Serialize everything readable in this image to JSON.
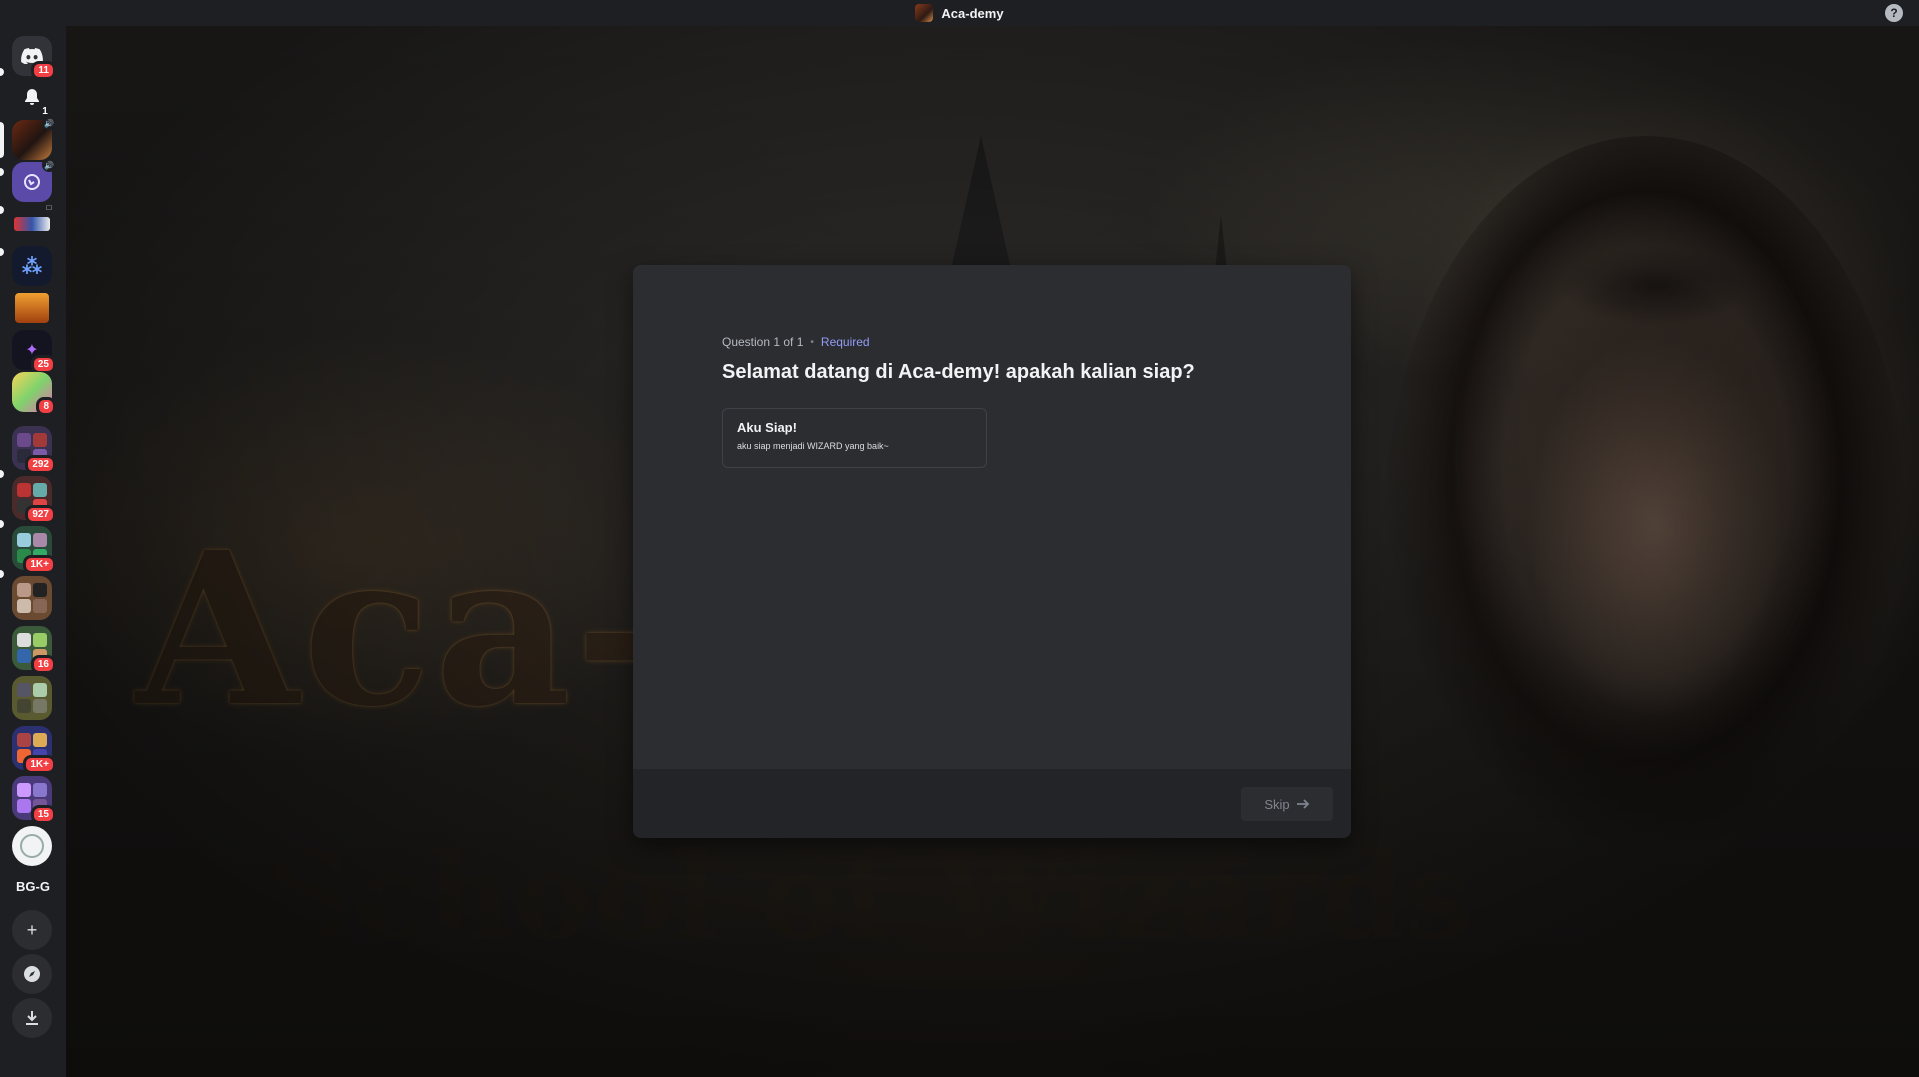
{
  "titlebar": {
    "title": "Aca-demy",
    "help_icon": "?"
  },
  "rail": {
    "home_badge": "11",
    "notifications_badge": "1",
    "servers": [
      {
        "name": "Aca-demy",
        "active": true
      },
      {
        "name": "server-2",
        "voice": true
      },
      {
        "name": "server-3"
      },
      {
        "name": "server-4"
      },
      {
        "name": "server-5"
      },
      {
        "name": "server-6",
        "badge": "25"
      },
      {
        "name": "server-7",
        "badge": "8"
      },
      {
        "name": "folder-1",
        "badge": "292"
      },
      {
        "name": "folder-2",
        "badge": "927"
      },
      {
        "name": "folder-3",
        "badge": "1K+"
      },
      {
        "name": "folder-4"
      },
      {
        "name": "folder-5",
        "badge": "16"
      },
      {
        "name": "folder-6"
      },
      {
        "name": "folder-7",
        "badge": "1K+"
      },
      {
        "name": "folder-8",
        "badge": "15"
      },
      {
        "name": "server-8"
      }
    ],
    "text_server": "BG-G",
    "add_icon": "+",
    "explore_icon": "compass",
    "download_icon": "download"
  },
  "modal": {
    "question_counter": "Question 1 of 1",
    "required_label": "Required",
    "question": "Selamat datang di Aca-demy! apakah kalian siap?",
    "option": {
      "title": "Aku Siap!",
      "description": "aku siap menjadi WIZARD yang baik~"
    },
    "skip_label": "Skip"
  },
  "colors": {
    "accent_required": "#949cf7",
    "badge_red": "#f23f43",
    "modal_bg": "#2b2d31",
    "footer_bg": "#232428"
  }
}
